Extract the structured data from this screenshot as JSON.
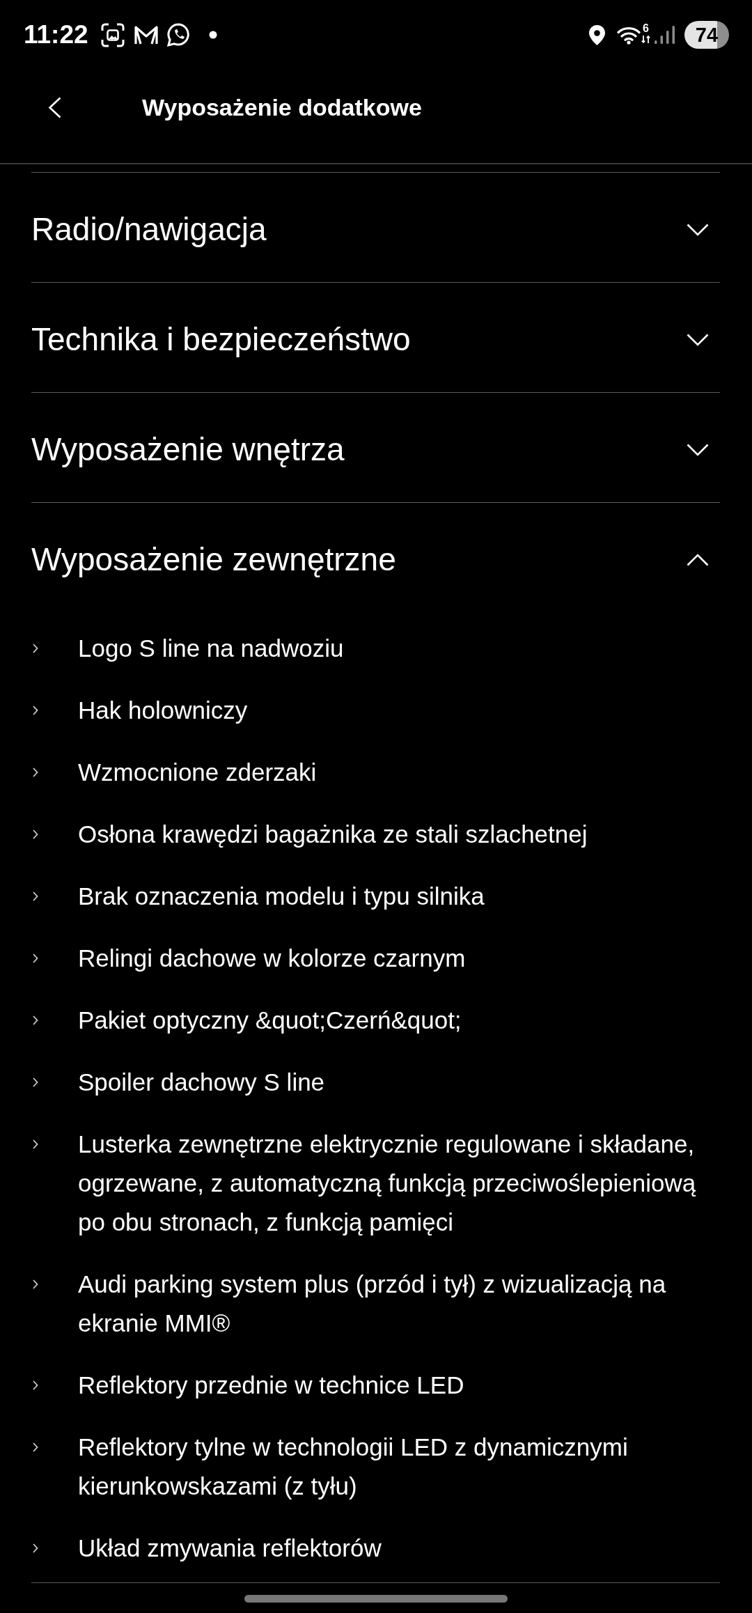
{
  "status_bar": {
    "time": "11:22",
    "wifi_badge": "6",
    "battery": "74"
  },
  "header": {
    "title": "Wyposażenie dodatkowe"
  },
  "sections": [
    {
      "title": "Radio/nawigacja",
      "expanded": false
    },
    {
      "title": "Technika i bezpieczeństwo",
      "expanded": false
    },
    {
      "title": "Wyposażenie wnętrza",
      "expanded": false
    },
    {
      "title": "Wyposażenie zewnętrzne",
      "expanded": true,
      "items": [
        "Logo S line na nadwoziu",
        "Hak holowniczy",
        "Wzmocnione zderzaki",
        "Osłona krawędzi bagażnika ze stali szlachetnej",
        "Brak oznaczenia modelu i typu silnika",
        "Relingi dachowe w kolorze czarnym",
        "Pakiet optyczny &quot;Czerń&quot;",
        "Spoiler dachowy S line",
        "Lusterka zewnętrzne elektrycznie regulowane i składane, ogrzewane, z automatyczną funkcją przeciwoślepieniową po obu stronach, z funkcją pamięci",
        "Audi parking system plus (przód i tył) z wizualizacją na ekranie MMI®",
        "Reflektory przednie w technice LED",
        "Reflektory tylne w technologii LED z dynamicznymi kierunkowskazami (z tyłu)",
        "Układ zmywania reflektorów"
      ]
    }
  ]
}
